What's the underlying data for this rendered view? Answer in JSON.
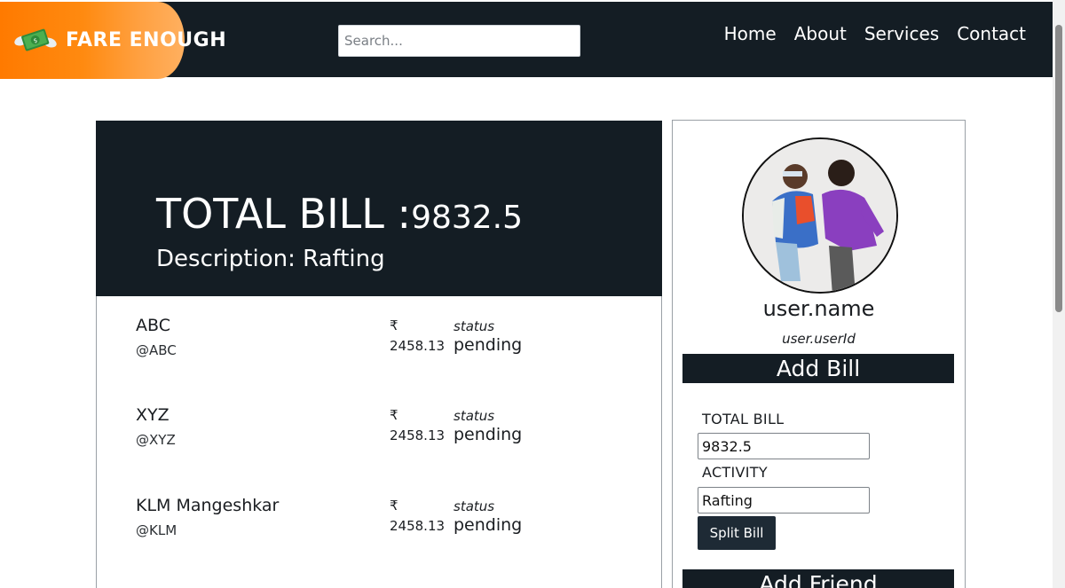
{
  "navbar": {
    "brand": "FARE ENOUGH",
    "search_placeholder": "Search...",
    "links": [
      "Home",
      "About",
      "Services",
      "Contact"
    ]
  },
  "bill": {
    "total_label": "TOTAL BILL :",
    "total_value": "9832.5",
    "description": "Description: Rafting",
    "rows": [
      {
        "name": "ABC",
        "handle": "@ABC",
        "currency": "₹",
        "amount": "2458.13",
        "status_label": "status",
        "status": "pending"
      },
      {
        "name": "XYZ",
        "handle": "@XYZ",
        "currency": "₹",
        "amount": "2458.13",
        "status_label": "status",
        "status": "pending"
      },
      {
        "name": "KLM Mangeshkar",
        "handle": "@KLM",
        "currency": "₹",
        "amount": "2458.13",
        "status_label": "status",
        "status": "pending"
      }
    ]
  },
  "profile": {
    "name": "user.name",
    "user_id": "user.userId",
    "add_bill_title": "Add Bill",
    "total_bill_label": "TOTAL BILL",
    "total_bill_value": "9832.5",
    "activity_label": "ACTIVITY",
    "activity_value": "Rafting",
    "split_button": "Split Bill",
    "add_friend_title": "Add Friend"
  },
  "colors": {
    "navbar_bg": "#141d24",
    "brand_orange": "#ff7a00",
    "panel_dark": "#141d24",
    "button_bg": "#1e2a35"
  },
  "icons": {
    "brand_logo": "flying-money-icon"
  }
}
